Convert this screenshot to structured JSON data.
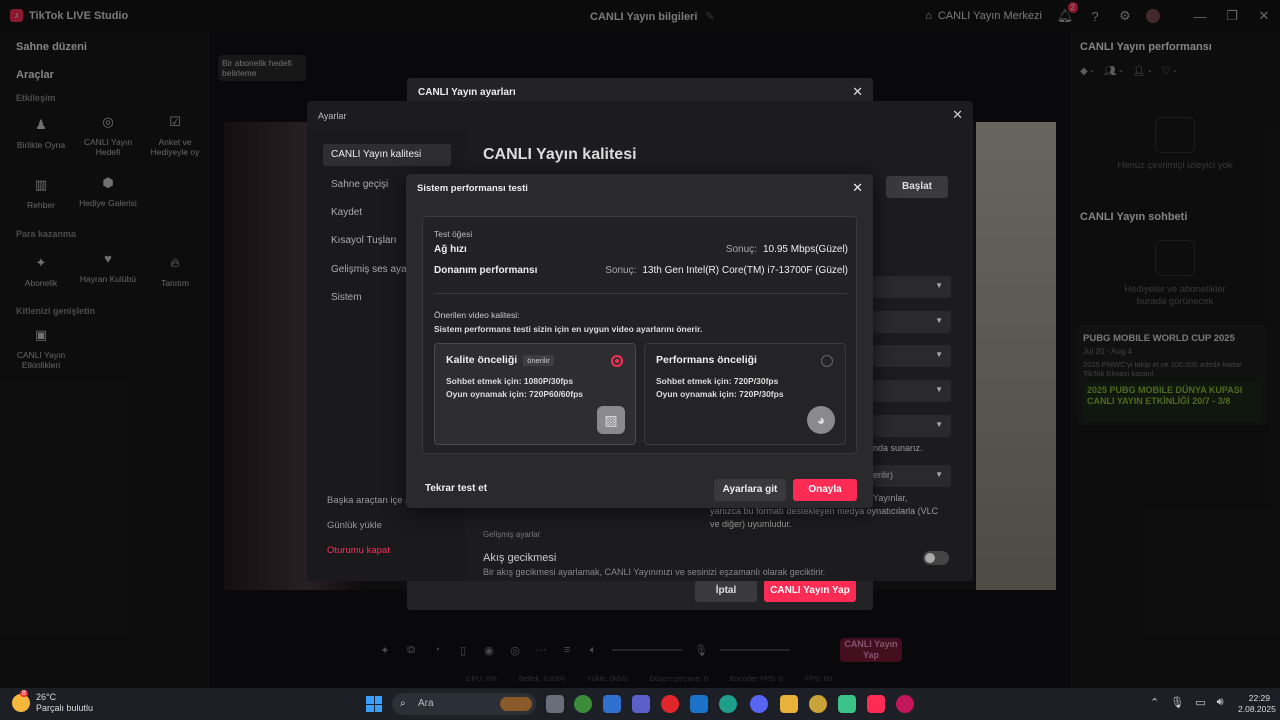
{
  "titlebar": {
    "app_name": "TikTok LIVE Studio",
    "center_title": "CANLI Yayın bilgileri",
    "live_center": "CANLI Yayın Merkezi",
    "notif_count": "2"
  },
  "left": {
    "scene_layout": "Sahne düzeni",
    "tools": "Araçlar",
    "sec_engagement": "Etkileşim",
    "sec_monetize": "Para kazanma",
    "sec_audience": "Kitlenizi genişletin",
    "tool_items": [
      "Birlikte Oyna",
      "CANLI Yayın Hedefi",
      "Anket ve Hediyeyle oy",
      "Rehber",
      "Hediye Galerisi",
      "Abonelik",
      "Hayran Kulübü",
      "Tanıtım",
      "CANLI Yayın Etkinlikleri"
    ]
  },
  "preview": {
    "sub_goal": "Bir abonelik hedefi belirleme"
  },
  "right": {
    "perf_title": "CANLI Yayın performansı",
    "stats": [
      "-",
      "-",
      "-",
      "-"
    ],
    "no_viewers": "Henüz çevrimiçi izleyici yok",
    "chat_title": "CANLI Yayın sohbeti",
    "chat_empty": "Hediyeler ve abonelikler burada görünecek",
    "pubg_title": "PUBG MOBILE WORLD CUP 2025",
    "pubg_date": "Jul 20 - Aug 4",
    "pubg_text": "2025 PMWC'yi takip et ve 100.000 adede kadar TikTok Elması kazan!",
    "pubg_banner": "2025 PUBG MOBILE DÜNYA KUPASI CANLI YAYIN ETKİNLİĞİ 20/7 - 3/8"
  },
  "live_dialog": {
    "title": "CANLI Yayın ayarları",
    "cancel": "İptal",
    "go_live": "CANLI Yayın Yap"
  },
  "settings": {
    "title": "Ayarlar",
    "nav": [
      "CANLI Yayın kalitesi",
      "Sahne geçişi",
      "Kaydet",
      "Kısayol Tuşları",
      "Gelişmiş ses ayarları",
      "Sistem"
    ],
    "nav_bottom": [
      "Başka araçtan içe aktar",
      "Günlük yükle",
      "Oturumu kapat"
    ],
    "heading": "CANLI Yayın kalitesi",
    "start": "Başlat",
    "partial_1": "nda sunarız.",
    "partial_2": "erilir)",
    "partial_3": "Yayınlar,",
    "partial_4": "yanızca bu formatı destekleyen medya oynatıcılarla (VLC ve diğer) uyumludur.",
    "advanced": "Gelişmiş ayarlar",
    "delay_title": "Akış gecikmesi",
    "delay_desc": "Bir akış gecikmesi ayarlamak, CANLI Yayınınızı ve sesinizi eşzamanlı olarak geciktirir."
  },
  "perf": {
    "title": "Sistem performansı testi",
    "test_item": "Test öğesi",
    "net_label": "Ağ hızı",
    "net_result_label": "Sonuç:",
    "net_result": "10.95 Mbps(Güzel)",
    "hw_label": "Donanım performansı",
    "hw_result_label": "Sonuç:",
    "hw_result": "13th Gen Intel(R) Core(TM) i7-13700F (Güzel)",
    "rec_label": "Önerilen video kalitesi:",
    "rec_desc": "Sistem performans testi sizin için en uygun video ayarlarını önerir.",
    "card1_title": "Kalite önceliği",
    "card1_tag": "önerilir",
    "card1_line1": "Sohbet etmek için: 1080P/30fps",
    "card1_line2": "Oyun oynamak için: 720P60/60fps",
    "card2_title": "Performans önceliği",
    "card2_line1": "Sohbet etmek için: 720P/30fps",
    "card2_line2": "Oyun oynamak için: 720P/30fps",
    "retest": "Tekrar test et",
    "go_settings": "Ayarlara git",
    "confirm": "Onayla"
  },
  "bottombar": {
    "live_btn": "CANLI Yayın Yap",
    "stats": [
      "CPU: 0%",
      "Bellek: 0.83%",
      "Yükle: 0kb/s",
      "Düşen çerçeve: 0",
      "Encoder FPS: 0",
      "FPS: 60"
    ]
  },
  "taskbar": {
    "temp": "26°C",
    "weather": "Parçalı bulutlu",
    "weather_badge": "8",
    "search": "Ara",
    "time": "22:29",
    "date": "2.08.2025"
  },
  "colors": {
    "accent": "#fe2c55"
  }
}
